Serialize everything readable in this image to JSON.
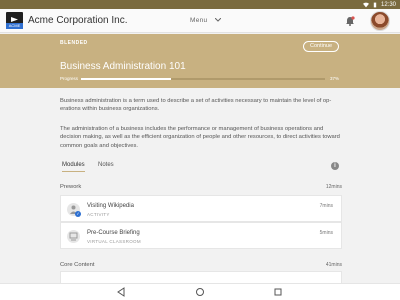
{
  "statusbar": {
    "time": "12:30",
    "icons": [
      "wifi-icon",
      "battery-icon"
    ]
  },
  "appbar": {
    "company": "Acme Corporation Inc.",
    "logo_text": "ACME",
    "menu_label": "Menu",
    "icons": [
      "bell-icon",
      "avatar"
    ]
  },
  "course": {
    "tag": "BLENDED",
    "continue_label": "Continue",
    "title": "Business Administration 101",
    "progress_label": "Progress",
    "progress_text": "37%",
    "progress": 0.37
  },
  "description": {
    "p1": "Business administration is a term used to describe a set of activities necessary to maintain the level of op-erations within business organizations.",
    "p2": "The administration of a business includes the performance or management of business operations and decision making, as well as the efficient organization of people and other resources, to direct activities toward common goals and objectives."
  },
  "tabs": {
    "modules": "Modules",
    "notes": "Notes"
  },
  "sections": {
    "prework": {
      "title": "Prework",
      "time": "12mins"
    },
    "core": {
      "title": "Core Content",
      "time": "41mins"
    }
  },
  "modules": [
    {
      "title": "Visiting Wikipedia",
      "sub": "ACTIVITY",
      "time": "7mins",
      "icon": "person-icon",
      "completed": true
    },
    {
      "title": "Pre-Course Briefing",
      "sub": "VIRTUAL CLASSROOM",
      "time": "5mins",
      "icon": "presentation-icon",
      "completed": false
    }
  ],
  "colors": {
    "hero": "#c8b181",
    "accent": "#2d6fd1"
  }
}
